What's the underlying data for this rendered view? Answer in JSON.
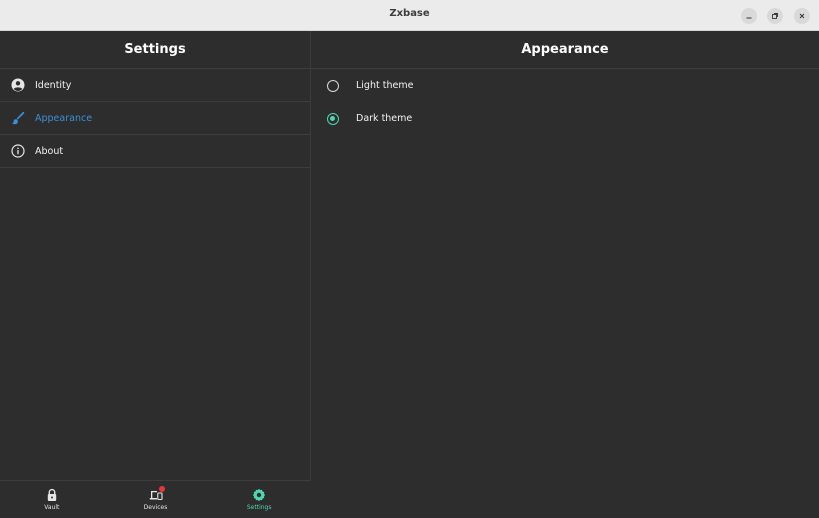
{
  "window": {
    "title": "Zxbase"
  },
  "settings": {
    "title": "Settings",
    "items": [
      {
        "label": "Identity",
        "icon": "account-circle-icon"
      },
      {
        "label": "Appearance",
        "icon": "brush-icon",
        "active": true
      },
      {
        "label": "About",
        "icon": "info-icon"
      }
    ]
  },
  "appearance": {
    "title": "Appearance",
    "options": [
      {
        "label": "Light theme",
        "selected": false
      },
      {
        "label": "Dark theme",
        "selected": true
      }
    ]
  },
  "bottom_nav": {
    "items": [
      {
        "label": "Vault",
        "icon": "lock-icon"
      },
      {
        "label": "Devices",
        "icon": "devices-icon",
        "badge": true
      },
      {
        "label": "Settings",
        "icon": "gear-icon",
        "active": true
      }
    ]
  },
  "colors": {
    "accent_blue": "#3d8fd6",
    "accent_teal": "#4fd6b0",
    "badge_red": "#e53935",
    "background": "#2d2d2d"
  }
}
